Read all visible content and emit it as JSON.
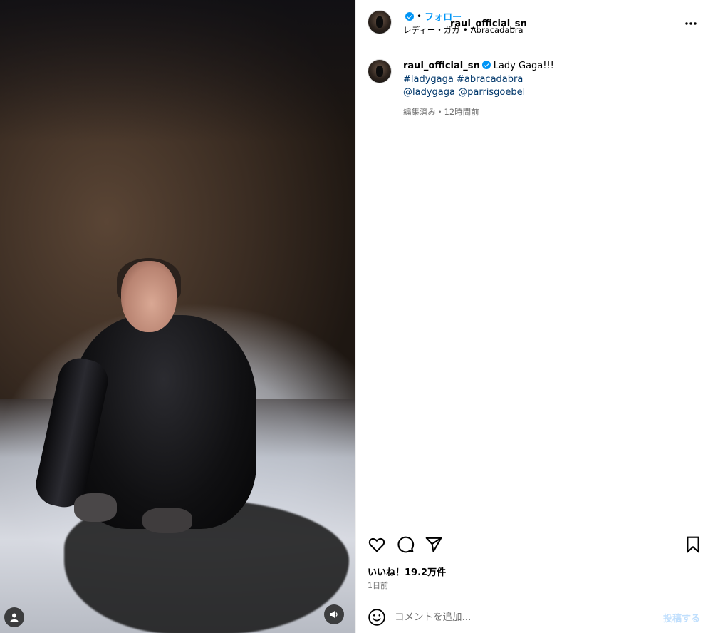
{
  "post": {
    "username": "raul_official_sn",
    "follow_label": "フォロー",
    "separator": "•",
    "audio_artist": "レディー・ガガ",
    "audio_track": "Abracadabra",
    "more_icon": "more-horizontal-icon"
  },
  "caption": {
    "username": "raul_official_sn",
    "text": "Lady Gaga!!!",
    "hashtags": [
      "#ladygaga",
      "#abracadabra"
    ],
    "mentions": [
      "@ladygaga",
      "@parrisgoebel"
    ],
    "meta": "編集済み・12時間前"
  },
  "actions": {
    "likes": "いいね！19.2万件",
    "time": "1日前"
  },
  "comment": {
    "placeholder": "コメントを追加...",
    "post_label": "投稿する"
  },
  "colors": {
    "accent": "#0095f6",
    "link": "#00376b",
    "muted": "#737373",
    "post_disabled": "#c0dffd"
  }
}
